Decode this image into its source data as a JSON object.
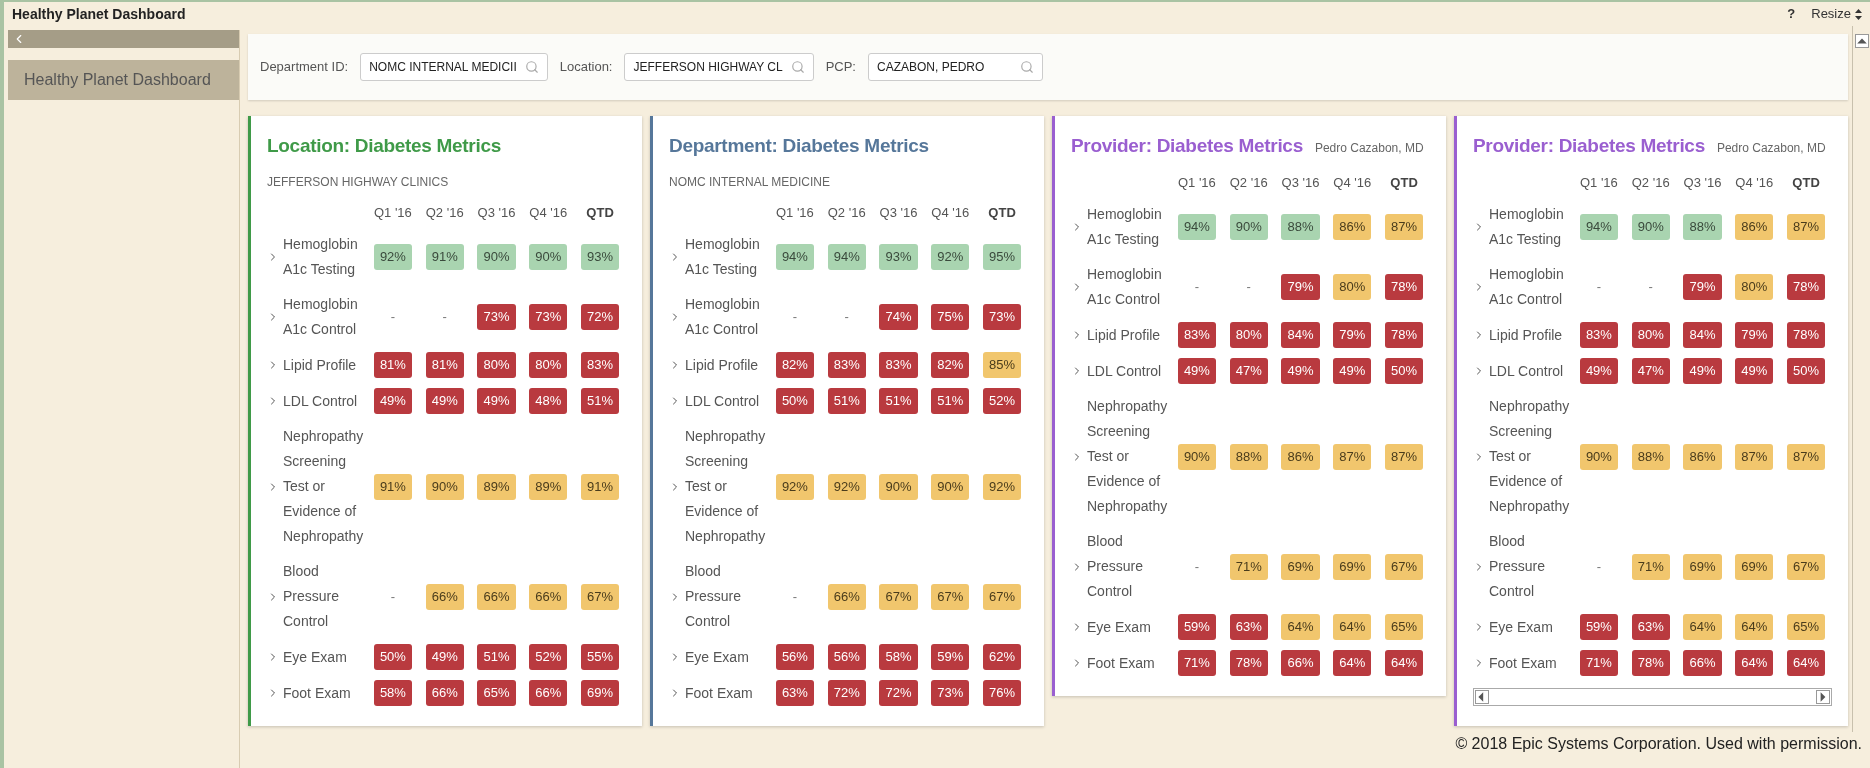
{
  "window": {
    "title": "Healthy Planet Dashboard",
    "help": "?",
    "resize": "Resize"
  },
  "sidebar": {
    "items": [
      {
        "label": "Healthy Planet Dashboard",
        "selected": true
      }
    ]
  },
  "filters": [
    {
      "label": "Department ID:",
      "value": "NOMC INTERNAL MEDICII"
    },
    {
      "label": "Location:",
      "value": "JEFFERSON HIGHWAY CL"
    },
    {
      "label": "PCP:",
      "value": "CAZABON, PEDRO"
    }
  ],
  "cards": [
    {
      "kind": "stacked",
      "title": "Location: Diabetes Metrics",
      "subtitle": "JEFFERSON HIGHWAY CLINICS",
      "color": "#3f9a48",
      "h_scrollbar": false,
      "columns": [
        "Q1 '16",
        "Q2 '16",
        "Q3 '16",
        "Q4 '16",
        "QTD"
      ],
      "rows": [
        {
          "label": "Hemoglobin A1c Testing",
          "cells": [
            {
              "text": "92%",
              "kind": "good"
            },
            {
              "text": "91%",
              "kind": "good"
            },
            {
              "text": "90%",
              "kind": "good"
            },
            {
              "text": "90%",
              "kind": "good"
            },
            {
              "text": "93%",
              "kind": "good"
            }
          ]
        },
        {
          "label": "Hemoglobin A1c Control",
          "cells": [
            {
              "text": "-",
              "kind": "empty"
            },
            {
              "text": "-",
              "kind": "empty"
            },
            {
              "text": "73%",
              "kind": "bad"
            },
            {
              "text": "73%",
              "kind": "bad"
            },
            {
              "text": "72%",
              "kind": "bad"
            }
          ]
        },
        {
          "label": "Lipid Profile",
          "cells": [
            {
              "text": "81%",
              "kind": "bad"
            },
            {
              "text": "81%",
              "kind": "bad"
            },
            {
              "text": "80%",
              "kind": "bad"
            },
            {
              "text": "80%",
              "kind": "bad"
            },
            {
              "text": "83%",
              "kind": "bad"
            }
          ]
        },
        {
          "label": "LDL Control",
          "cells": [
            {
              "text": "49%",
              "kind": "bad"
            },
            {
              "text": "49%",
              "kind": "bad"
            },
            {
              "text": "49%",
              "kind": "bad"
            },
            {
              "text": "48%",
              "kind": "bad"
            },
            {
              "text": "51%",
              "kind": "bad"
            }
          ]
        },
        {
          "label": "Nephropathy Screening Test or Evidence of Nephropathy",
          "cells": [
            {
              "text": "91%",
              "kind": "warn"
            },
            {
              "text": "90%",
              "kind": "warn"
            },
            {
              "text": "89%",
              "kind": "warn"
            },
            {
              "text": "89%",
              "kind": "warn"
            },
            {
              "text": "91%",
              "kind": "warn"
            }
          ]
        },
        {
          "label": "Blood Pressure Control",
          "cells": [
            {
              "text": "-",
              "kind": "empty"
            },
            {
              "text": "66%",
              "kind": "warn"
            },
            {
              "text": "66%",
              "kind": "warn"
            },
            {
              "text": "66%",
              "kind": "warn"
            },
            {
              "text": "67%",
              "kind": "warn"
            }
          ]
        },
        {
          "label": "Eye Exam",
          "cells": [
            {
              "text": "50%",
              "kind": "bad"
            },
            {
              "text": "49%",
              "kind": "bad"
            },
            {
              "text": "51%",
              "kind": "bad"
            },
            {
              "text": "52%",
              "kind": "bad"
            },
            {
              "text": "55%",
              "kind": "bad"
            }
          ]
        },
        {
          "label": "Foot Exam",
          "cells": [
            {
              "text": "58%",
              "kind": "bad"
            },
            {
              "text": "66%",
              "kind": "bad"
            },
            {
              "text": "65%",
              "kind": "bad"
            },
            {
              "text": "66%",
              "kind": "bad"
            },
            {
              "text": "69%",
              "kind": "bad"
            }
          ]
        }
      ]
    },
    {
      "kind": "stacked",
      "title": "Department: Diabetes Metrics",
      "subtitle": "NOMC INTERNAL MEDICINE",
      "color": "#56779a",
      "h_scrollbar": false,
      "columns": [
        "Q1 '16",
        "Q2 '16",
        "Q3 '16",
        "Q4 '16",
        "QTD"
      ],
      "rows": [
        {
          "label": "Hemoglobin A1c Testing",
          "cells": [
            {
              "text": "94%",
              "kind": "good"
            },
            {
              "text": "94%",
              "kind": "good"
            },
            {
              "text": "93%",
              "kind": "good"
            },
            {
              "text": "92%",
              "kind": "good"
            },
            {
              "text": "95%",
              "kind": "good"
            }
          ]
        },
        {
          "label": "Hemoglobin A1c Control",
          "cells": [
            {
              "text": "-",
              "kind": "empty"
            },
            {
              "text": "-",
              "kind": "empty"
            },
            {
              "text": "74%",
              "kind": "bad"
            },
            {
              "text": "75%",
              "kind": "bad"
            },
            {
              "text": "73%",
              "kind": "bad"
            }
          ]
        },
        {
          "label": "Lipid Profile",
          "cells": [
            {
              "text": "82%",
              "kind": "bad"
            },
            {
              "text": "83%",
              "kind": "bad"
            },
            {
              "text": "83%",
              "kind": "bad"
            },
            {
              "text": "82%",
              "kind": "bad"
            },
            {
              "text": "85%",
              "kind": "warn"
            }
          ]
        },
        {
          "label": "LDL Control",
          "cells": [
            {
              "text": "50%",
              "kind": "bad"
            },
            {
              "text": "51%",
              "kind": "bad"
            },
            {
              "text": "51%",
              "kind": "bad"
            },
            {
              "text": "51%",
              "kind": "bad"
            },
            {
              "text": "52%",
              "kind": "bad"
            }
          ]
        },
        {
          "label": "Nephropathy Screening Test or Evidence of Nephropathy",
          "cells": [
            {
              "text": "92%",
              "kind": "warn"
            },
            {
              "text": "92%",
              "kind": "warn"
            },
            {
              "text": "90%",
              "kind": "warn"
            },
            {
              "text": "90%",
              "kind": "warn"
            },
            {
              "text": "92%",
              "kind": "warn"
            }
          ]
        },
        {
          "label": "Blood Pressure Control",
          "cells": [
            {
              "text": "-",
              "kind": "empty"
            },
            {
              "text": "66%",
              "kind": "warn"
            },
            {
              "text": "67%",
              "kind": "warn"
            },
            {
              "text": "67%",
              "kind": "warn"
            },
            {
              "text": "67%",
              "kind": "warn"
            }
          ]
        },
        {
          "label": "Eye Exam",
          "cells": [
            {
              "text": "56%",
              "kind": "bad"
            },
            {
              "text": "56%",
              "kind": "bad"
            },
            {
              "text": "58%",
              "kind": "bad"
            },
            {
              "text": "59%",
              "kind": "bad"
            },
            {
              "text": "62%",
              "kind": "bad"
            }
          ]
        },
        {
          "label": "Foot Exam",
          "cells": [
            {
              "text": "63%",
              "kind": "bad"
            },
            {
              "text": "72%",
              "kind": "bad"
            },
            {
              "text": "72%",
              "kind": "bad"
            },
            {
              "text": "73%",
              "kind": "bad"
            },
            {
              "text": "76%",
              "kind": "bad"
            }
          ]
        }
      ]
    },
    {
      "kind": "inline",
      "title": "Provider: Diabetes Metrics",
      "subtitle": "Pedro Cazabon, MD",
      "color": "#9a5fd0",
      "h_scrollbar": false,
      "columns": [
        "Q1 '16",
        "Q2 '16",
        "Q3 '16",
        "Q4 '16",
        "QTD"
      ],
      "rows": [
        {
          "label": "Hemoglobin A1c Testing",
          "cells": [
            {
              "text": "94%",
              "kind": "good"
            },
            {
              "text": "90%",
              "kind": "good"
            },
            {
              "text": "88%",
              "kind": "good"
            },
            {
              "text": "86%",
              "kind": "warn"
            },
            {
              "text": "87%",
              "kind": "warn"
            }
          ]
        },
        {
          "label": "Hemoglobin A1c Control",
          "cells": [
            {
              "text": "-",
              "kind": "empty"
            },
            {
              "text": "-",
              "kind": "empty"
            },
            {
              "text": "79%",
              "kind": "bad"
            },
            {
              "text": "80%",
              "kind": "warn"
            },
            {
              "text": "78%",
              "kind": "bad"
            }
          ]
        },
        {
          "label": "Lipid Profile",
          "cells": [
            {
              "text": "83%",
              "kind": "bad"
            },
            {
              "text": "80%",
              "kind": "bad"
            },
            {
              "text": "84%",
              "kind": "bad"
            },
            {
              "text": "79%",
              "kind": "bad"
            },
            {
              "text": "78%",
              "kind": "bad"
            }
          ]
        },
        {
          "label": "LDL Control",
          "cells": [
            {
              "text": "49%",
              "kind": "bad"
            },
            {
              "text": "47%",
              "kind": "bad"
            },
            {
              "text": "49%",
              "kind": "bad"
            },
            {
              "text": "49%",
              "kind": "bad"
            },
            {
              "text": "50%",
              "kind": "bad"
            }
          ]
        },
        {
          "label": "Nephropathy Screening Test or Evidence of Nephropathy",
          "cells": [
            {
              "text": "90%",
              "kind": "warn"
            },
            {
              "text": "88%",
              "kind": "warn"
            },
            {
              "text": "86%",
              "kind": "warn"
            },
            {
              "text": "87%",
              "kind": "warn"
            },
            {
              "text": "87%",
              "kind": "warn"
            }
          ]
        },
        {
          "label": "Blood Pressure Control",
          "cells": [
            {
              "text": "-",
              "kind": "empty"
            },
            {
              "text": "71%",
              "kind": "warn"
            },
            {
              "text": "69%",
              "kind": "warn"
            },
            {
              "text": "69%",
              "kind": "warn"
            },
            {
              "text": "67%",
              "kind": "warn"
            }
          ]
        },
        {
          "label": "Eye Exam",
          "cells": [
            {
              "text": "59%",
              "kind": "bad"
            },
            {
              "text": "63%",
              "kind": "bad"
            },
            {
              "text": "64%",
              "kind": "warn"
            },
            {
              "text": "64%",
              "kind": "warn"
            },
            {
              "text": "65%",
              "kind": "warn"
            }
          ]
        },
        {
          "label": "Foot Exam",
          "cells": [
            {
              "text": "71%",
              "kind": "bad"
            },
            {
              "text": "78%",
              "kind": "bad"
            },
            {
              "text": "66%",
              "kind": "bad"
            },
            {
              "text": "64%",
              "kind": "bad"
            },
            {
              "text": "64%",
              "kind": "bad"
            }
          ]
        }
      ]
    },
    {
      "kind": "inline",
      "title": "Provider: Diabetes Metrics",
      "subtitle": "Pedro Cazabon, MD",
      "color": "#9a5fd0",
      "h_scrollbar": true,
      "columns": [
        "Q1 '16",
        "Q2 '16",
        "Q3 '16",
        "Q4 '16",
        "QTD"
      ],
      "rows": [
        {
          "label": "Hemoglobin A1c Testing",
          "cells": [
            {
              "text": "94%",
              "kind": "good"
            },
            {
              "text": "90%",
              "kind": "good"
            },
            {
              "text": "88%",
              "kind": "good"
            },
            {
              "text": "86%",
              "kind": "warn"
            },
            {
              "text": "87%",
              "kind": "warn"
            }
          ]
        },
        {
          "label": "Hemoglobin A1c Control",
          "cells": [
            {
              "text": "-",
              "kind": "empty"
            },
            {
              "text": "-",
              "kind": "empty"
            },
            {
              "text": "79%",
              "kind": "bad"
            },
            {
              "text": "80%",
              "kind": "warn"
            },
            {
              "text": "78%",
              "kind": "bad"
            }
          ]
        },
        {
          "label": "Lipid Profile",
          "cells": [
            {
              "text": "83%",
              "kind": "bad"
            },
            {
              "text": "80%",
              "kind": "bad"
            },
            {
              "text": "84%",
              "kind": "bad"
            },
            {
              "text": "79%",
              "kind": "bad"
            },
            {
              "text": "78%",
              "kind": "bad"
            }
          ]
        },
        {
          "label": "LDL Control",
          "cells": [
            {
              "text": "49%",
              "kind": "bad"
            },
            {
              "text": "47%",
              "kind": "bad"
            },
            {
              "text": "49%",
              "kind": "bad"
            },
            {
              "text": "49%",
              "kind": "bad"
            },
            {
              "text": "50%",
              "kind": "bad"
            }
          ]
        },
        {
          "label": "Nephropathy Screening Test or Evidence of Nephropathy",
          "cells": [
            {
              "text": "90%",
              "kind": "warn"
            },
            {
              "text": "88%",
              "kind": "warn"
            },
            {
              "text": "86%",
              "kind": "warn"
            },
            {
              "text": "87%",
              "kind": "warn"
            },
            {
              "text": "87%",
              "kind": "warn"
            }
          ]
        },
        {
          "label": "Blood Pressure Control",
          "cells": [
            {
              "text": "-",
              "kind": "empty"
            },
            {
              "text": "71%",
              "kind": "warn"
            },
            {
              "text": "69%",
              "kind": "warn"
            },
            {
              "text": "69%",
              "kind": "warn"
            },
            {
              "text": "67%",
              "kind": "warn"
            }
          ]
        },
        {
          "label": "Eye Exam",
          "cells": [
            {
              "text": "59%",
              "kind": "bad"
            },
            {
              "text": "63%",
              "kind": "bad"
            },
            {
              "text": "64%",
              "kind": "warn"
            },
            {
              "text": "64%",
              "kind": "warn"
            },
            {
              "text": "65%",
              "kind": "warn"
            }
          ]
        },
        {
          "label": "Foot Exam",
          "cells": [
            {
              "text": "71%",
              "kind": "bad"
            },
            {
              "text": "78%",
              "kind": "bad"
            },
            {
              "text": "66%",
              "kind": "bad"
            },
            {
              "text": "64%",
              "kind": "bad"
            },
            {
              "text": "64%",
              "kind": "bad"
            }
          ]
        }
      ]
    }
  ],
  "footer": "© 2018 Epic Systems Corporation. Used with permission."
}
